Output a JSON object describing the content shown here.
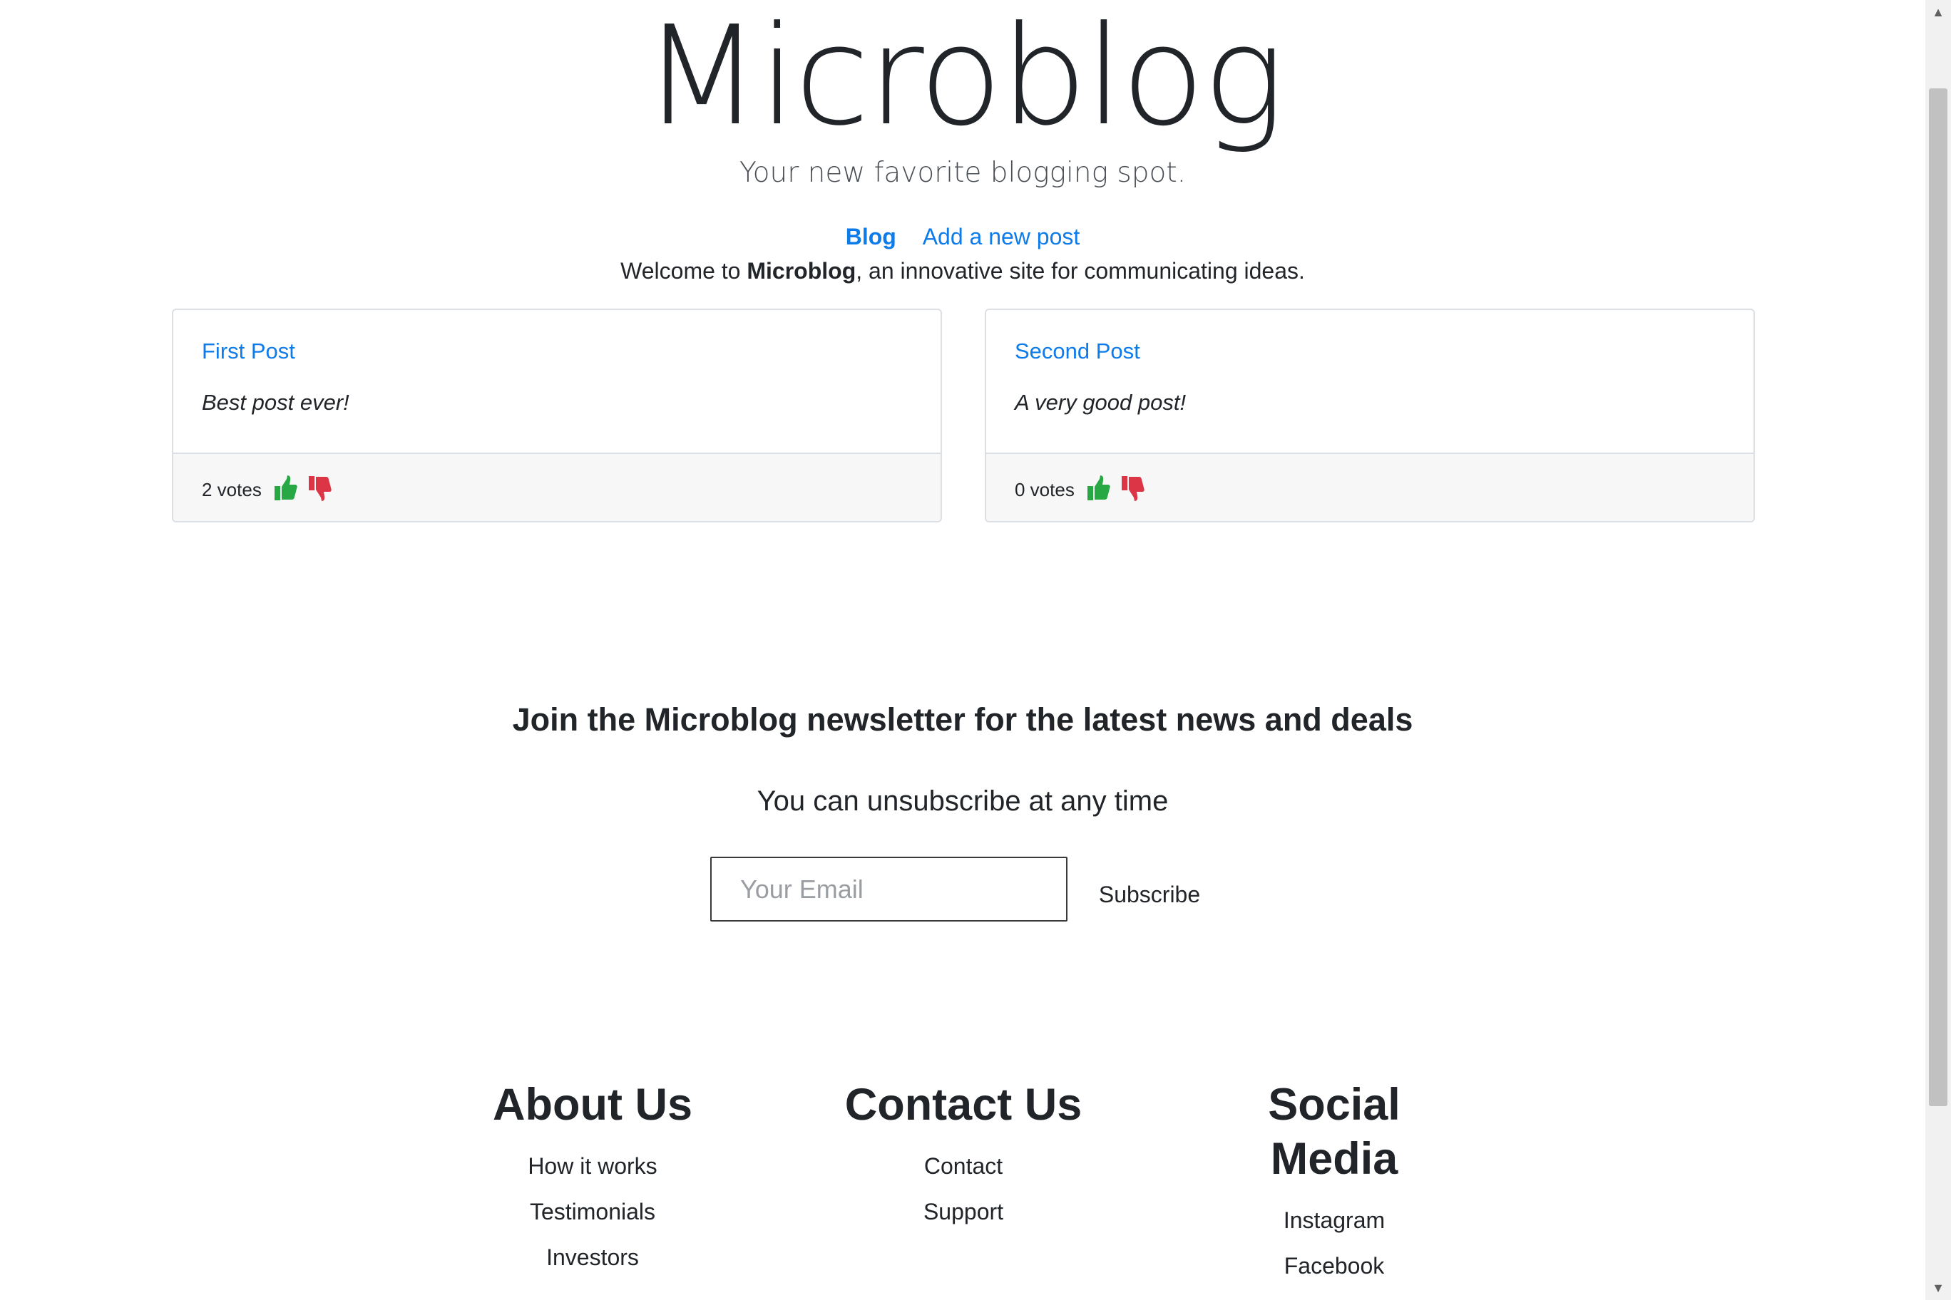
{
  "header": {
    "title": "Microblog",
    "tagline": "Your new favorite blogging spot."
  },
  "nav": {
    "items": [
      {
        "label": "Blog",
        "active": true
      },
      {
        "label": "Add a new post",
        "active": false
      }
    ]
  },
  "welcome": {
    "prefix": "Welcome to ",
    "site_name": "Microblog",
    "suffix": ", an innovative site for communicating ideas."
  },
  "posts": [
    {
      "title": "First Post",
      "text": "Best post ever!",
      "votes": "2 votes"
    },
    {
      "title": "Second Post",
      "text": "A very good post!",
      "votes": "0 votes"
    }
  ],
  "icons": {
    "upvote": "thumbs-up-icon",
    "downvote": "thumbs-down-icon"
  },
  "colors": {
    "link": "#0d7bea",
    "upvote": "#28a745",
    "downvote": "#dc3545",
    "card_footer_bg": "#f7f7f7"
  },
  "newsletter": {
    "title": "Join the Microblog newsletter for the latest news and deals",
    "subtitle": "You can unsubscribe at any time",
    "email_placeholder": "Your Email",
    "email_value": "",
    "subscribe_label": "Subscribe"
  },
  "footer": {
    "about": {
      "heading": "About Us",
      "links": [
        "How it works",
        "Testimonials",
        "Investors"
      ]
    },
    "contact": {
      "heading": "Contact Us",
      "links": [
        "Contact",
        "Support"
      ]
    },
    "social": {
      "heading": "Social Media",
      "links": [
        "Instagram",
        "Facebook"
      ]
    }
  }
}
